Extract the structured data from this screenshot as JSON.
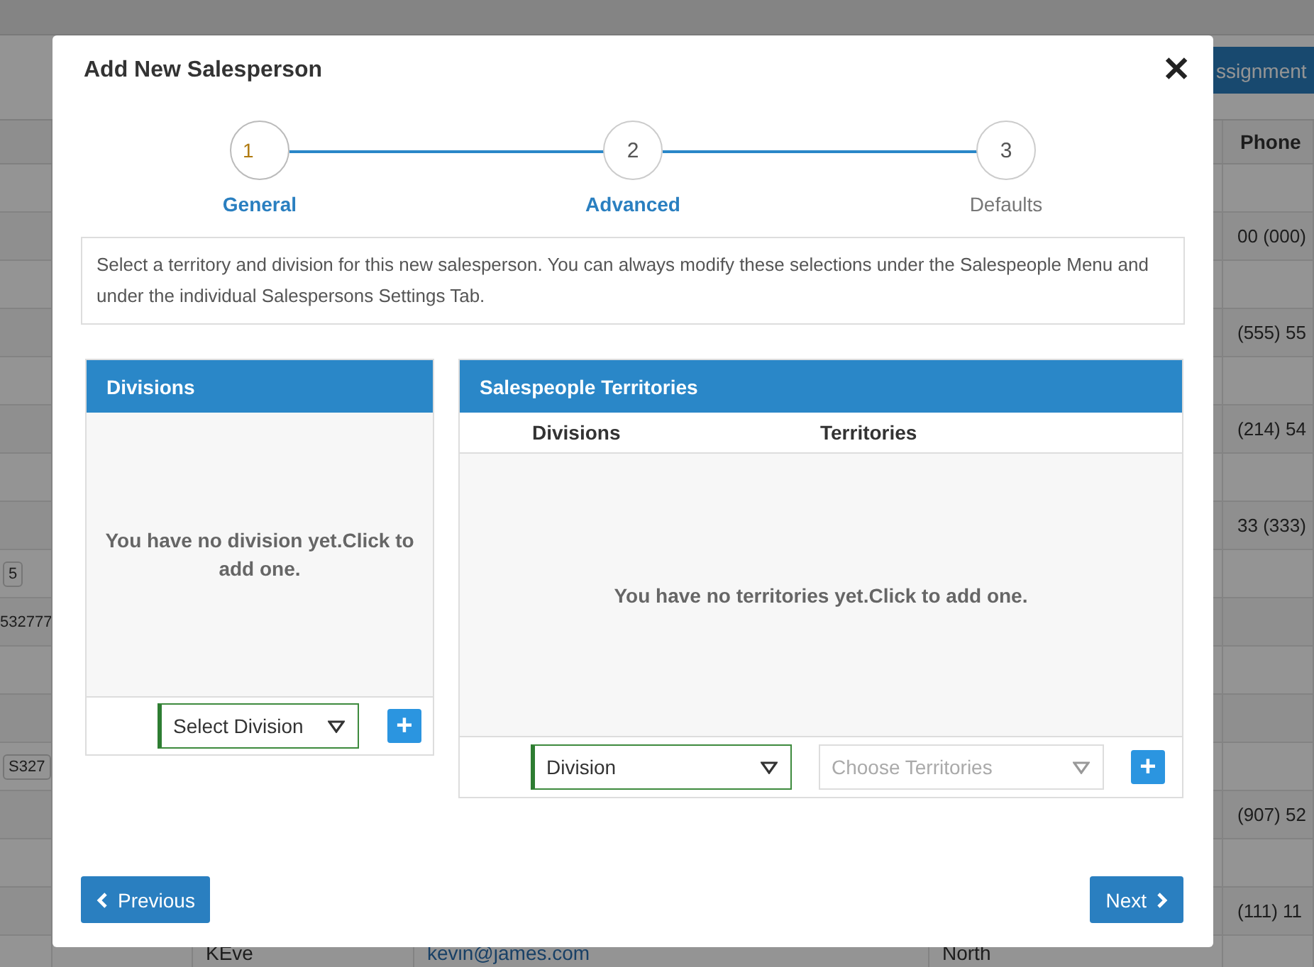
{
  "background": {
    "toolbar_button": "ssignment",
    "phone_header": "Phone",
    "rows": [
      {},
      {
        "phone": "00 (000)"
      },
      {},
      {
        "phone": "(555) 55"
      },
      {},
      {
        "phone": "(214) 54"
      },
      {},
      {
        "phone": "33 (333)"
      },
      {
        "left": {
          "text": "5",
          "kind": "badge"
        }
      },
      {
        "left": {
          "text": "532777",
          "kind": "text"
        }
      },
      {},
      {},
      {
        "left": {
          "text": "S327",
          "kind": "badge"
        }
      },
      {
        "phone": "(907) 52"
      },
      {},
      {
        "phone": "(111) 11"
      }
    ],
    "last_row": {
      "name": "KEve",
      "email": "kevin@james.com",
      "region": "North"
    }
  },
  "modal": {
    "title": "Add New Salesperson",
    "close": "✕",
    "steps": [
      {
        "number": "1",
        "label": "General",
        "selected": true,
        "visited": true
      },
      {
        "number": "2",
        "label": "Advanced",
        "selected": false,
        "visited": true
      },
      {
        "number": "3",
        "label": "Defaults",
        "selected": false,
        "visited": false
      }
    ],
    "info": "Select a territory and division for this new salesperson. You can always modify these selections under the Salespeople Menu and under the individual Salespersons Settings Tab.",
    "divisions": {
      "title": "Divisions",
      "empty": "You have no division yet.Click to add one.",
      "select": {
        "value": "Select Division"
      },
      "add": "+"
    },
    "territories": {
      "title": "Salespeople Territories",
      "columns": [
        "Divisions",
        "Territories"
      ],
      "empty": "You have no territories yet.Click to add one.",
      "division_select": {
        "value": "Division"
      },
      "territory_select": {
        "placeholder": "Choose Territories"
      },
      "add": "+"
    },
    "buttons": [
      {
        "label": "Previous",
        "kind": "back"
      },
      {
        "label": "Next",
        "kind": "forward"
      }
    ]
  }
}
